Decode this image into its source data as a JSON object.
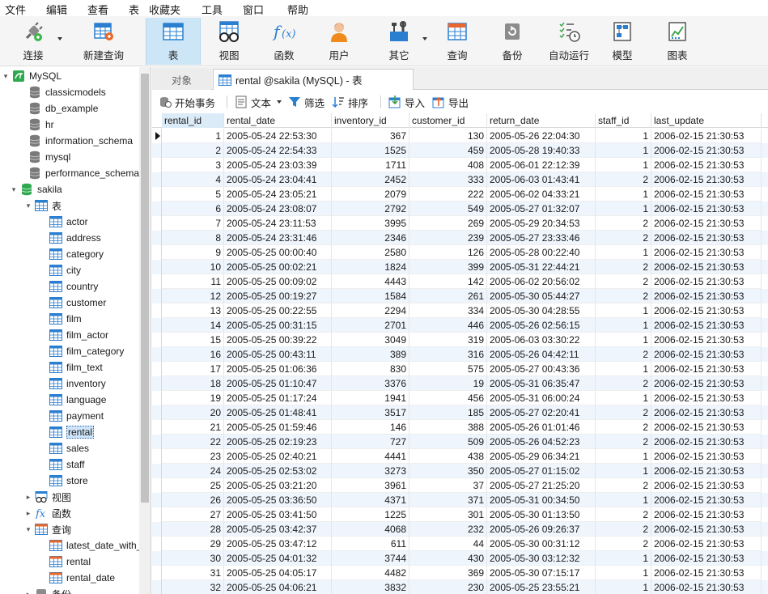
{
  "menu": [
    "文件",
    "编辑",
    "查看",
    "表",
    "收藏夹",
    "工具",
    "窗口",
    "帮助"
  ],
  "toolbar": {
    "connect": "连接",
    "new_query": "新建查询",
    "table": "表",
    "view": "视图",
    "function": "函数",
    "user": "用户",
    "other": "其它",
    "query": "查询",
    "backup": "备份",
    "auto_run": "自动运行",
    "model": "模型",
    "chart": "图表"
  },
  "tree": {
    "root": "MySQL",
    "databases": [
      "classicmodels",
      "db_example",
      "hr",
      "information_schema",
      "mysql",
      "performance_schema"
    ],
    "open_db": "sakila",
    "tables_label": "表",
    "tables": [
      "actor",
      "address",
      "category",
      "city",
      "country",
      "customer",
      "film",
      "film_actor",
      "film_category",
      "film_text",
      "inventory",
      "language",
      "payment",
      "rental",
      "sales",
      "staff",
      "store"
    ],
    "selected_table": "rental",
    "views_label": "视图",
    "functions_label": "函数",
    "queries_label": "查询",
    "queries": [
      "latest_date_with_",
      "rental",
      "rental_date"
    ],
    "backup_label": "备份"
  },
  "tabs": {
    "objects": "对象",
    "active": "rental @sakila (MySQL) - 表"
  },
  "table_toolbar": {
    "begin_tx": "开始事务",
    "text": "文本",
    "filter": "筛选",
    "sort": "排序",
    "import": "导入",
    "export": "导出"
  },
  "grid": {
    "columns": [
      "rental_id",
      "rental_date",
      "inventory_id",
      "customer_id",
      "return_date",
      "staff_id",
      "last_update"
    ],
    "rows": [
      [
        "1",
        "2005-05-24 22:53:30",
        "367",
        "130",
        "2005-05-26 22:04:30",
        "1",
        "2006-02-15 21:30:53"
      ],
      [
        "2",
        "2005-05-24 22:54:33",
        "1525",
        "459",
        "2005-05-28 19:40:33",
        "1",
        "2006-02-15 21:30:53"
      ],
      [
        "3",
        "2005-05-24 23:03:39",
        "1711",
        "408",
        "2005-06-01 22:12:39",
        "1",
        "2006-02-15 21:30:53"
      ],
      [
        "4",
        "2005-05-24 23:04:41",
        "2452",
        "333",
        "2005-06-03 01:43:41",
        "2",
        "2006-02-15 21:30:53"
      ],
      [
        "5",
        "2005-05-24 23:05:21",
        "2079",
        "222",
        "2005-06-02 04:33:21",
        "1",
        "2006-02-15 21:30:53"
      ],
      [
        "6",
        "2005-05-24 23:08:07",
        "2792",
        "549",
        "2005-05-27 01:32:07",
        "1",
        "2006-02-15 21:30:53"
      ],
      [
        "7",
        "2005-05-24 23:11:53",
        "3995",
        "269",
        "2005-05-29 20:34:53",
        "2",
        "2006-02-15 21:30:53"
      ],
      [
        "8",
        "2005-05-24 23:31:46",
        "2346",
        "239",
        "2005-05-27 23:33:46",
        "2",
        "2006-02-15 21:30:53"
      ],
      [
        "9",
        "2005-05-25 00:00:40",
        "2580",
        "126",
        "2005-05-28 00:22:40",
        "1",
        "2006-02-15 21:30:53"
      ],
      [
        "10",
        "2005-05-25 00:02:21",
        "1824",
        "399",
        "2005-05-31 22:44:21",
        "2",
        "2006-02-15 21:30:53"
      ],
      [
        "11",
        "2005-05-25 00:09:02",
        "4443",
        "142",
        "2005-06-02 20:56:02",
        "2",
        "2006-02-15 21:30:53"
      ],
      [
        "12",
        "2005-05-25 00:19:27",
        "1584",
        "261",
        "2005-05-30 05:44:27",
        "2",
        "2006-02-15 21:30:53"
      ],
      [
        "13",
        "2005-05-25 00:22:55",
        "2294",
        "334",
        "2005-05-30 04:28:55",
        "1",
        "2006-02-15 21:30:53"
      ],
      [
        "14",
        "2005-05-25 00:31:15",
        "2701",
        "446",
        "2005-05-26 02:56:15",
        "1",
        "2006-02-15 21:30:53"
      ],
      [
        "15",
        "2005-05-25 00:39:22",
        "3049",
        "319",
        "2005-06-03 03:30:22",
        "1",
        "2006-02-15 21:30:53"
      ],
      [
        "16",
        "2005-05-25 00:43:11",
        "389",
        "316",
        "2005-05-26 04:42:11",
        "2",
        "2006-02-15 21:30:53"
      ],
      [
        "17",
        "2005-05-25 01:06:36",
        "830",
        "575",
        "2005-05-27 00:43:36",
        "1",
        "2006-02-15 21:30:53"
      ],
      [
        "18",
        "2005-05-25 01:10:47",
        "3376",
        "19",
        "2005-05-31 06:35:47",
        "2",
        "2006-02-15 21:30:53"
      ],
      [
        "19",
        "2005-05-25 01:17:24",
        "1941",
        "456",
        "2005-05-31 06:00:24",
        "1",
        "2006-02-15 21:30:53"
      ],
      [
        "20",
        "2005-05-25 01:48:41",
        "3517",
        "185",
        "2005-05-27 02:20:41",
        "2",
        "2006-02-15 21:30:53"
      ],
      [
        "21",
        "2005-05-25 01:59:46",
        "146",
        "388",
        "2005-05-26 01:01:46",
        "2",
        "2006-02-15 21:30:53"
      ],
      [
        "22",
        "2005-05-25 02:19:23",
        "727",
        "509",
        "2005-05-26 04:52:23",
        "2",
        "2006-02-15 21:30:53"
      ],
      [
        "23",
        "2005-05-25 02:40:21",
        "4441",
        "438",
        "2005-05-29 06:34:21",
        "1",
        "2006-02-15 21:30:53"
      ],
      [
        "24",
        "2005-05-25 02:53:02",
        "3273",
        "350",
        "2005-05-27 01:15:02",
        "1",
        "2006-02-15 21:30:53"
      ],
      [
        "25",
        "2005-05-25 03:21:20",
        "3961",
        "37",
        "2005-05-27 21:25:20",
        "2",
        "2006-02-15 21:30:53"
      ],
      [
        "26",
        "2005-05-25 03:36:50",
        "4371",
        "371",
        "2005-05-31 00:34:50",
        "1",
        "2006-02-15 21:30:53"
      ],
      [
        "27",
        "2005-05-25 03:41:50",
        "1225",
        "301",
        "2005-05-30 01:13:50",
        "2",
        "2006-02-15 21:30:53"
      ],
      [
        "28",
        "2005-05-25 03:42:37",
        "4068",
        "232",
        "2005-05-26 09:26:37",
        "2",
        "2006-02-15 21:30:53"
      ],
      [
        "29",
        "2005-05-25 03:47:12",
        "611",
        "44",
        "2005-05-30 00:31:12",
        "2",
        "2006-02-15 21:30:53"
      ],
      [
        "30",
        "2005-05-25 04:01:32",
        "3744",
        "430",
        "2005-05-30 03:12:32",
        "1",
        "2006-02-15 21:30:53"
      ],
      [
        "31",
        "2005-05-25 04:05:17",
        "4482",
        "369",
        "2005-05-30 07:15:17",
        "1",
        "2006-02-15 21:30:53"
      ],
      [
        "32",
        "2005-05-25 04:06:21",
        "3832",
        "230",
        "2005-05-25 23:55:21",
        "1",
        "2006-02-15 21:30:53"
      ]
    ]
  },
  "colors": {
    "accent": "#2b7fd0",
    "toolbar_active": "#cde6f7",
    "row_alt": "#eef5fd",
    "db_green": "#2fa84f"
  }
}
